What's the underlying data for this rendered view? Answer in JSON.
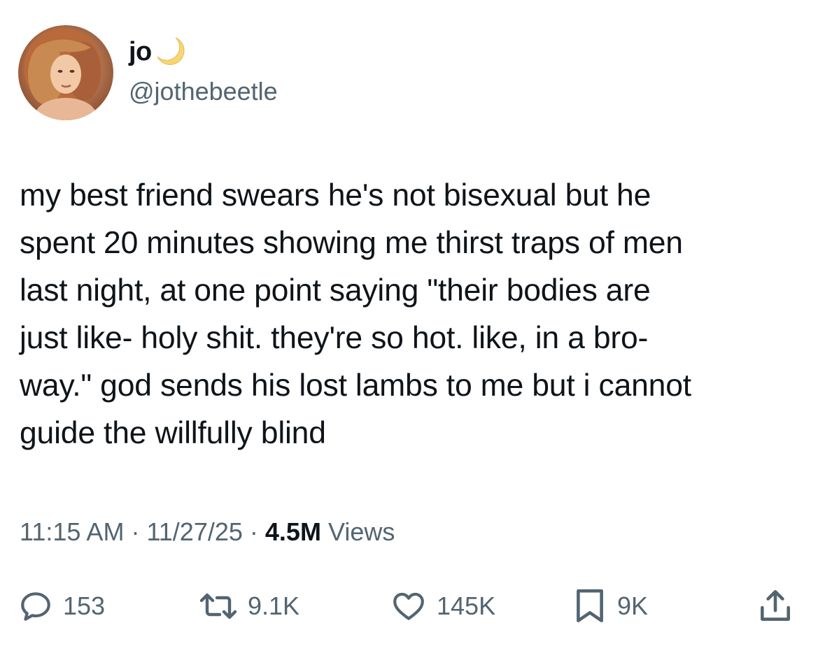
{
  "author": {
    "display_name": "jo",
    "handle": "@jothebeetle",
    "avatar_icon": "profile-photo",
    "name_emoji_icon": "crescent-moon-icon"
  },
  "tweet": {
    "text": "my best friend swears he's not bisexual but he\nspent 20 minutes showing me thirst traps of men\nlast night, at one point saying \"their bodies are\njust like- holy shit. they're so hot. like, in a bro-\nway.\" god sends his lost lambs to me but i cannot\nguide the willfully blind"
  },
  "meta": {
    "time": "11:15 AM",
    "separator1": " · ",
    "date": "11/27/25",
    "separator2": " · ",
    "views_count": "4.5M",
    "views_label": " Views"
  },
  "actions": {
    "reply": {
      "icon": "reply-icon",
      "count": "153"
    },
    "retweet": {
      "icon": "retweet-icon",
      "count": "9.1K"
    },
    "like": {
      "icon": "heart-icon",
      "count": "145K"
    },
    "bookmark": {
      "icon": "bookmark-icon",
      "count": "9K"
    },
    "share": {
      "icon": "share-icon"
    }
  },
  "colors": {
    "text_primary": "#0f1419",
    "text_secondary": "#536471",
    "moon": "#f7d774"
  }
}
